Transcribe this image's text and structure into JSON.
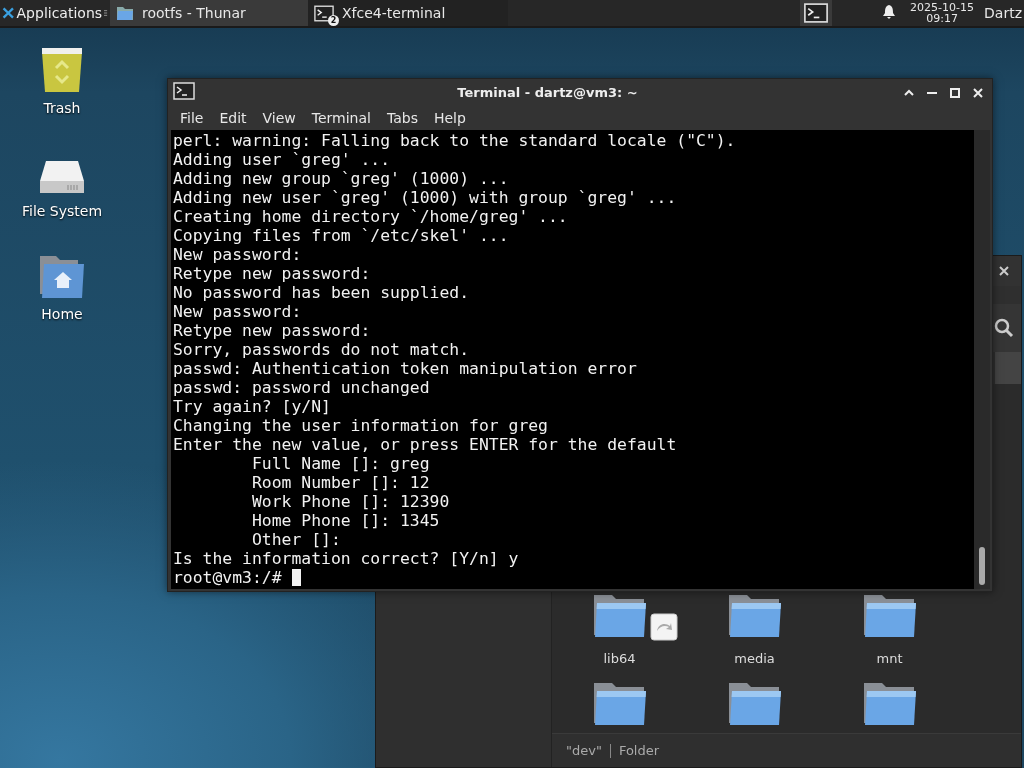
{
  "panel": {
    "menu_label": "Applications",
    "tasks": [
      {
        "label": "rootfs - Thunar",
        "kind": "folder",
        "selected": false
      },
      {
        "label": "Xfce4-terminal",
        "kind": "terminal",
        "badge": "2",
        "selected": true
      }
    ],
    "date": "2025-10-15",
    "time": "09:17",
    "user": "Dartz"
  },
  "desktop_icons": [
    {
      "label": "Trash",
      "kind": "trash"
    },
    {
      "label": "File System",
      "kind": "drive"
    },
    {
      "label": "Home",
      "kind": "home"
    }
  ],
  "file_manager": {
    "folders": [
      {
        "label": "lib64",
        "kind": "symlink"
      },
      {
        "label": "media",
        "kind": "folder"
      },
      {
        "label": "mnt",
        "kind": "folder"
      },
      {
        "kind": "folder"
      },
      {
        "kind": "folder"
      },
      {
        "kind": "folder"
      }
    ],
    "status": [
      "\"dev\"",
      "Folder"
    ]
  },
  "terminal": {
    "title": "Terminal - dartz@vm3: ~",
    "menu": [
      "File",
      "Edit",
      "View",
      "Terminal",
      "Tabs",
      "Help"
    ],
    "lines": [
      "perl: warning: Falling back to the standard locale (\"C\").",
      "Adding user `greg' ...",
      "Adding new group `greg' (1000) ...",
      "Adding new user `greg' (1000) with group `greg' ...",
      "Creating home directory `/home/greg' ...",
      "Copying files from `/etc/skel' ...",
      "New password:",
      "Retype new password:",
      "No password has been supplied.",
      "New password:",
      "Retype new password:",
      "Sorry, passwords do not match.",
      "passwd: Authentication token manipulation error",
      "passwd: password unchanged",
      "Try again? [y/N]",
      "Changing the user information for greg",
      "Enter the new value, or press ENTER for the default",
      "        Full Name []: greg",
      "        Room Number []: 12",
      "        Work Phone []: 12390",
      "        Home Phone []: 1345",
      "        Other []:",
      "Is the information correct? [Y/n] y"
    ],
    "prompt": "root@vm3:/#"
  }
}
